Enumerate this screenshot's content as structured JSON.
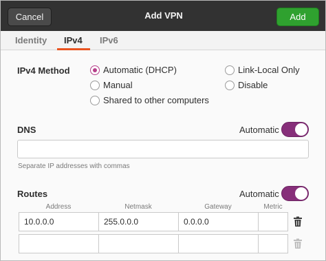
{
  "header": {
    "cancel_label": "Cancel",
    "title": "Add VPN",
    "add_label": "Add"
  },
  "tabs": [
    {
      "label": "Identity",
      "active": false
    },
    {
      "label": "IPv4",
      "active": true
    },
    {
      "label": "IPv6",
      "active": false
    }
  ],
  "ipv4_method": {
    "label": "IPv4 Method",
    "options": {
      "automatic": {
        "label": "Automatic (DHCP)",
        "checked": true
      },
      "manual": {
        "label": "Manual",
        "checked": false
      },
      "shared": {
        "label": "Shared to other computers",
        "checked": false
      },
      "link_local": {
        "label": "Link-Local Only",
        "checked": false
      },
      "disable": {
        "label": "Disable",
        "checked": false
      }
    }
  },
  "dns": {
    "label": "DNS",
    "automatic_label": "Automatic",
    "automatic_on": true,
    "value": "",
    "hint": "Separate IP addresses with commas"
  },
  "routes": {
    "label": "Routes",
    "automatic_label": "Automatic",
    "automatic_on": true,
    "columns": [
      "Address",
      "Netmask",
      "Gateway",
      "Metric"
    ],
    "rows": [
      {
        "address": "10.0.0.0",
        "netmask": "255.0.0.0",
        "gateway": "0.0.0.0",
        "metric": ""
      },
      {
        "address": "",
        "netmask": "",
        "gateway": "",
        "metric": ""
      }
    ]
  },
  "colors": {
    "accent_tab": "#e95420",
    "radio_checked": "#b63f8a",
    "switch_on": "#872f7a",
    "add_button": "#2fa12f",
    "headerbar": "#323232"
  }
}
